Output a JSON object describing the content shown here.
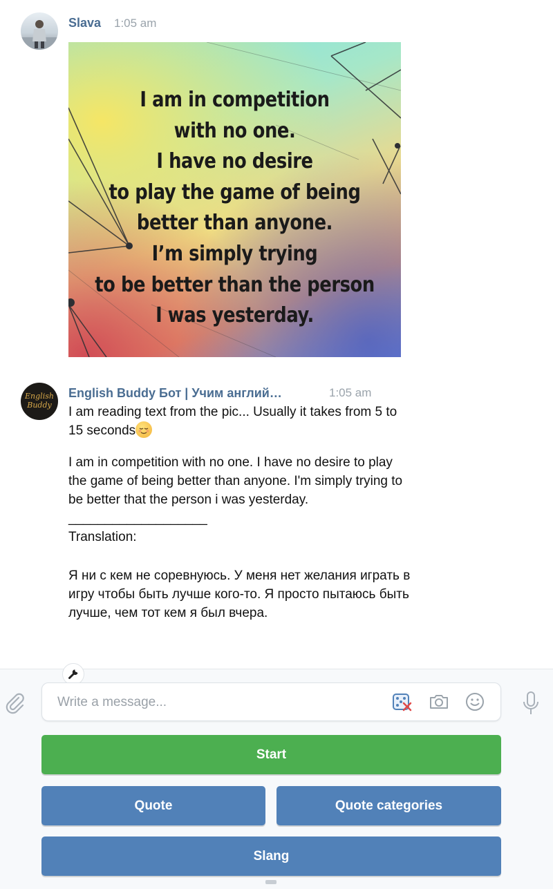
{
  "messages": [
    {
      "sender": "Slava",
      "time": "1:05 am",
      "image_text": [
        "I am in competition",
        "with no one.",
        "I have no desire",
        "to play the game of being",
        "better than anyone.",
        "I’m simply trying",
        "to be better than the person",
        "I was yesterday."
      ]
    },
    {
      "sender": "English Buddy Бот | Учим англий…",
      "time": "1:05 am",
      "avatar_text": [
        "English",
        "Buddy"
      ],
      "lines": [
        "I am reading text from the pic... Usually it takes from 5 to",
        "15 seconds",
        "I am in competition with no one. I have no desire to play",
        "the game of being better than anyone. I'm simply trying to",
        "be better that the person i was yesterday.",
        "___________________",
        "Translation:",
        "Я ни с кем не соревнуюсь. У меня нет желания играть в",
        "игру чтобы быть лучше кого-то. Я просто пытаюсь быть",
        "лучше, чем тот кем я был вчера."
      ],
      "emoji": "relieved-face"
    }
  ],
  "composer": {
    "placeholder": "Write a message..."
  },
  "keyboard": {
    "start": "Start",
    "quote": "Quote",
    "quote_categories": "Quote categories",
    "slang": "Slang"
  },
  "colors": {
    "sender_name": "#4a6d92",
    "timestamp": "#9aa3ab",
    "start_button": "#4caf50",
    "keyboard_button": "#5181b8"
  },
  "icons": [
    "attach-icon",
    "wrench-icon",
    "dice-icon",
    "camera-icon",
    "smile-icon",
    "mic-icon"
  ]
}
